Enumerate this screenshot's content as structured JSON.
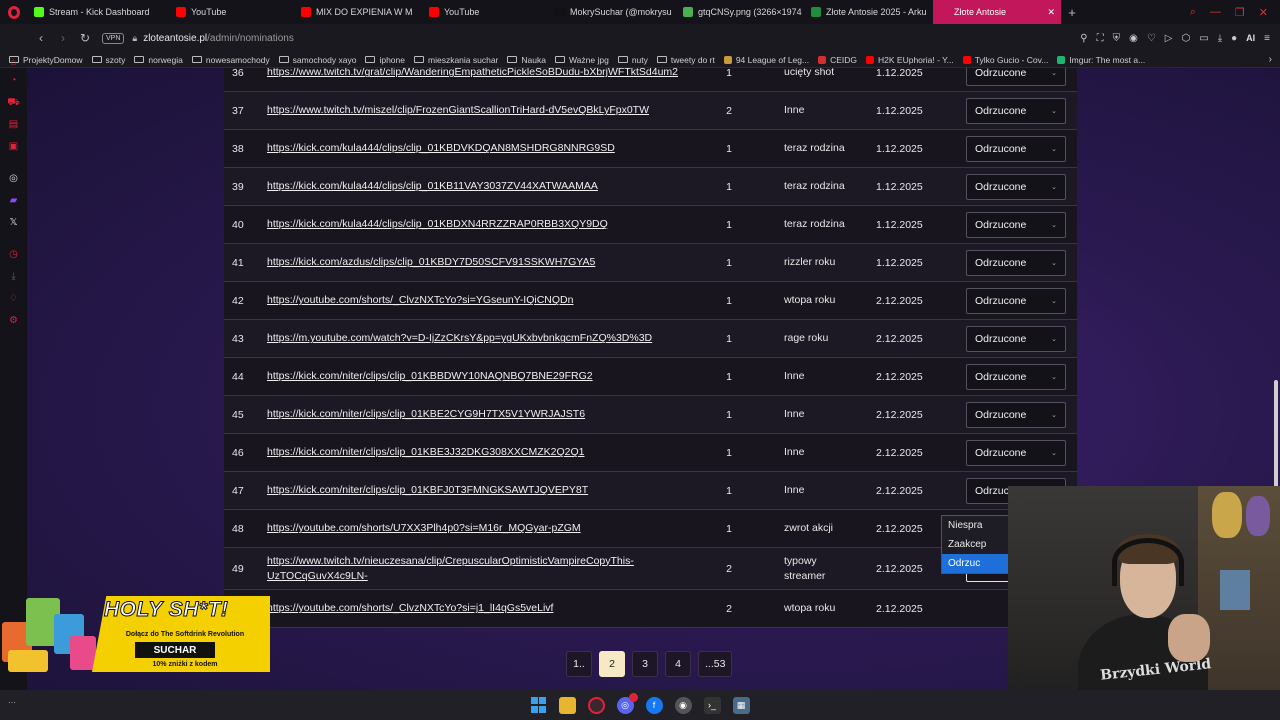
{
  "browser": {
    "tabs": [
      {
        "label": "Stream - Kick Dashboard",
        "icon": "kick-icon",
        "color": "#53fc18",
        "active": false
      },
      {
        "label": "YouTube",
        "icon": "youtube-icon",
        "color": "#ff0000",
        "active": false
      },
      {
        "label": "MIX DO EXPIENIA W M",
        "icon": "youtube-icon",
        "color": "#ff0000",
        "active": false
      },
      {
        "label": "YouTube",
        "icon": "youtube-icon",
        "color": "#ff0000",
        "active": false
      },
      {
        "label": "MokrySuchar (@mokrysu",
        "icon": "tiktok-icon",
        "color": "#111111",
        "active": false
      },
      {
        "label": "gtqCNSy.png (3266×1974",
        "icon": "image-icon",
        "color": "#4caf50",
        "active": false
      },
      {
        "label": "Złote Antosie 2025 - Arku",
        "icon": "sheets-icon",
        "color": "#1e8e3e",
        "active": false
      },
      {
        "label": "Złote Antosie",
        "icon": "site-icon",
        "color": "#c2185b",
        "active": true
      }
    ],
    "url_host": "zloteantosie.pl",
    "url_path": "/admin/nominations",
    "vpn_label": "VPN",
    "ai_label": "AI"
  },
  "bookmarks": [
    {
      "label": "ProjektyDomow",
      "type": "folder"
    },
    {
      "label": "szoty",
      "type": "folder"
    },
    {
      "label": "norwegia",
      "type": "folder"
    },
    {
      "label": "nowesamochody",
      "type": "folder"
    },
    {
      "label": "samochody xayo",
      "type": "folder"
    },
    {
      "label": "iphone",
      "type": "folder"
    },
    {
      "label": "mieszkania suchar",
      "type": "folder"
    },
    {
      "label": "Nauka",
      "type": "folder"
    },
    {
      "label": "Ważne jpg",
      "type": "folder"
    },
    {
      "label": "nuty",
      "type": "folder"
    },
    {
      "label": "tweety do rt",
      "type": "folder"
    },
    {
      "label": "94 League of Leg...",
      "type": "site",
      "color": "#c89b3c"
    },
    {
      "label": "CEIDG",
      "type": "site",
      "color": "#d32f2f"
    },
    {
      "label": "H2K EUphoria! - Y...",
      "type": "site",
      "color": "#ff0000"
    },
    {
      "label": "Tylko Gucio - Cov...",
      "type": "site",
      "color": "#ff0000"
    },
    {
      "label": "Imgur: The most a...",
      "type": "site",
      "color": "#1bb76e"
    }
  ],
  "nominations": [
    {
      "id": "36",
      "url": "https://www.twitch.tv/grat/clip/WanderingEmpatheticPickleSoBDudu-bXbrjWFTktSd4um2",
      "votes": "1",
      "category": "ucięty shot",
      "date": "1.12.2025",
      "status": "Odrzucone"
    },
    {
      "id": "37",
      "url": "https://www.twitch.tv/miszel/clip/FrozenGiantScallionTriHard-dV5evQBkLyFpx0TW",
      "votes": "2",
      "category": "Inne",
      "date": "1.12.2025",
      "status": "Odrzucone"
    },
    {
      "id": "38",
      "url": "https://kick.com/kula444/clips/clip_01KBDVKDQAN8MSHDRG8NNRG9SD",
      "votes": "1",
      "category": "teraz rodzina",
      "date": "1.12.2025",
      "status": "Odrzucone"
    },
    {
      "id": "39",
      "url": "https://kick.com/kula444/clips/clip_01KB11VAY3037ZV44XATWAAMAA",
      "votes": "1",
      "category": "teraz rodzina",
      "date": "1.12.2025",
      "status": "Odrzucone"
    },
    {
      "id": "40",
      "url": "https://kick.com/kula444/clips/clip_01KBDXN4RRZZRAP0RBB3XQY9DQ",
      "votes": "1",
      "category": "teraz rodzina",
      "date": "1.12.2025",
      "status": "Odrzucone"
    },
    {
      "id": "41",
      "url": "https://kick.com/azdus/clips/clip_01KBDY7D50SCFV91SSKWH7GYA5",
      "votes": "1",
      "category": "rizzler roku",
      "date": "1.12.2025",
      "status": "Odrzucone"
    },
    {
      "id": "42",
      "url": "https://youtube.com/shorts/_ClvzNXTcYo?si=YGseunY-IQiCNQDn",
      "votes": "1",
      "category": "wtopa roku",
      "date": "2.12.2025",
      "status": "Odrzucone"
    },
    {
      "id": "43",
      "url": "https://m.youtube.com/watch?v=D-IjZzCKrsY&pp=ygUKxbvbnkgcmFnZQ%3D%3D",
      "votes": "1",
      "category": "rage roku",
      "date": "2.12.2025",
      "status": "Odrzucone"
    },
    {
      "id": "44",
      "url": "https://kick.com/niter/clips/clip_01KBBDWY10NAQNBQ7BNE29FRG2",
      "votes": "1",
      "category": "Inne",
      "date": "2.12.2025",
      "status": "Odrzucone"
    },
    {
      "id": "45",
      "url": "https://kick.com/niter/clips/clip_01KBE2CYG9H7TX5V1YWRJAJST6",
      "votes": "1",
      "category": "Inne",
      "date": "2.12.2025",
      "status": "Odrzucone"
    },
    {
      "id": "46",
      "url": "https://kick.com/niter/clips/clip_01KBE3J32DKG308XXCMZK2Q2Q1",
      "votes": "1",
      "category": "Inne",
      "date": "2.12.2025",
      "status": "Odrzucone"
    },
    {
      "id": "47",
      "url": "https://kick.com/niter/clips/clip_01KBFJ0T3FMNGKSAWTJQVEPY8T",
      "votes": "1",
      "category": "Inne",
      "date": "2.12.2025",
      "status": "Odrzuc"
    },
    {
      "id": "48",
      "url": "https://youtube.com/shorts/U7XX3Plh4p0?si=M16r_MQGyar-pZGM",
      "votes": "1",
      "category": "zwrot akcji",
      "date": "2.12.2025",
      "status": "Odrzuc"
    },
    {
      "id": "49",
      "url": "https://www.twitch.tv/nieuczesana/clip/CrepuscularOptimisticVampireCopyThis-UzTOCqGuvX4c9LN-",
      "votes": "2",
      "category": "typowy streamer",
      "date": "2.12.2025",
      "status": "Niespra"
    },
    {
      "id": "50",
      "url": "https://youtube.com/shorts/_ClvzNXTcYo?si=j1_lI4qGs5veLivf",
      "votes": "2",
      "category": "wtopa roku",
      "date": "2.12.2025",
      "status": ""
    }
  ],
  "status_dropdown": {
    "options": [
      "Niespra",
      "Zaakcep",
      "Odrzuc"
    ],
    "highlighted_index": 2
  },
  "pagination": {
    "pages": [
      "1..",
      "2",
      "3",
      "4",
      "...53"
    ],
    "current": "2"
  },
  "ad": {
    "title": "HOLY SH*T!",
    "subtitle": "Dołącz do The Softdrink Revolution",
    "code": "SUCHAR",
    "discount": "10% zniżki z kodem"
  },
  "webcam": {
    "shirt_text": "Brzydki World"
  }
}
